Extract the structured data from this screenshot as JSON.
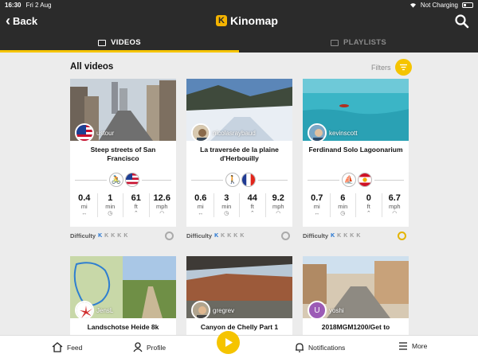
{
  "status": {
    "time": "16:30",
    "date": "Fri 2 Aug",
    "charging": "Not Charging"
  },
  "header": {
    "back_label": "Back",
    "app_name": "Kinomap"
  },
  "tabs": [
    {
      "label": "VIDEOS",
      "active": true
    },
    {
      "label": "PLAYLISTS",
      "active": false
    }
  ],
  "main": {
    "heading": "All videos",
    "filters_label": "Filters"
  },
  "cards": [
    {
      "user": "ustour",
      "title": "Steep streets of San Francisco",
      "sport": "cycling-icon",
      "flag": "flag-usa-icon",
      "stats": [
        {
          "v": "0.4",
          "u": "mi"
        },
        {
          "v": "1",
          "u": "min"
        },
        {
          "v": "61",
          "u": "ft"
        },
        {
          "v": "12.6",
          "u": "mph"
        }
      ],
      "difficulty_label": "Difficulty",
      "difficulty_level": 1,
      "medal": "silver"
    },
    {
      "user": "nicolasraybaud",
      "title": "La traversée de la plaine d'Herbouilly",
      "sport": "hiking-icon",
      "flag": "flag-france-icon",
      "stats": [
        {
          "v": "0.6",
          "u": "mi"
        },
        {
          "v": "3",
          "u": "min"
        },
        {
          "v": "44",
          "u": "ft"
        },
        {
          "v": "9.2",
          "u": "mph"
        }
      ],
      "difficulty_label": "Difficulty",
      "difficulty_level": 1,
      "medal": "silver"
    },
    {
      "user": "kevinscott",
      "title": "Ferdinand Solo Lagoonarium",
      "sport": "rowing-icon",
      "flag": "flag-french-polynesia-icon",
      "stats": [
        {
          "v": "0.7",
          "u": "mi"
        },
        {
          "v": "6",
          "u": "min"
        },
        {
          "v": "0",
          "u": "ft"
        },
        {
          "v": "6.7",
          "u": "mph"
        }
      ],
      "difficulty_label": "Difficulty",
      "difficulty_level": 1,
      "medal": "gold"
    },
    {
      "user": "JensL",
      "title": "Landschotse Heide 8k"
    },
    {
      "user": "gregrev",
      "title": "Canyon de Chelly Part 1"
    },
    {
      "user": "yoshi",
      "title": "2018MGM1200/Get to",
      "avatar_letter": "U"
    }
  ],
  "bottom_nav": {
    "feed": "Feed",
    "profile": "Profile",
    "notifications": "Notifications",
    "more": "More"
  },
  "colors": {
    "accent": "#f5c400",
    "bar": "#2b2b2b",
    "difficulty_on": "#1a6fd0"
  }
}
